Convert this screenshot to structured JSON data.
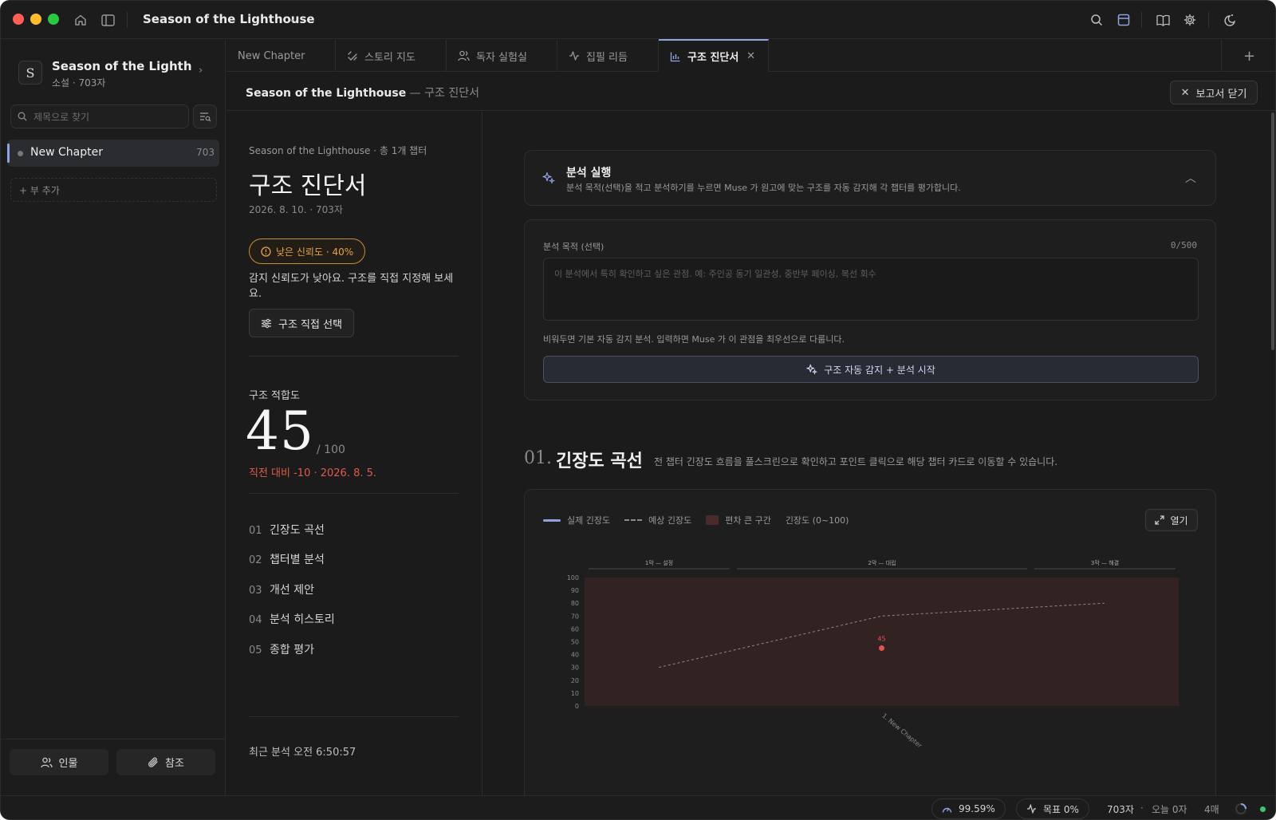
{
  "titlebar": {
    "title": "Season of the Lighthouse"
  },
  "sidebar": {
    "project_initial": "S",
    "project_name": "Season of the Lighthou...",
    "project_meta": "소설 · 703자",
    "search_placeholder": "제목으로 찾기",
    "chapter": {
      "name": "New Chapter",
      "count": "703"
    },
    "add_part": "+ 부 추가",
    "footer": {
      "characters": "인물",
      "references": "참조"
    }
  },
  "tabs": [
    {
      "label": "New Chapter",
      "icon": ""
    },
    {
      "label": "스토리 지도",
      "icon": "story-map-icon"
    },
    {
      "label": "독자 실험실",
      "icon": "users-icon"
    },
    {
      "label": "집필 리듬",
      "icon": "pulse-icon"
    },
    {
      "label": "구조 진단서",
      "icon": "bar-chart-icon"
    }
  ],
  "doc_header": {
    "title": "Season of the Lighthouse",
    "subtitle": " — 구조 진단서",
    "close_label": "보고서 닫기"
  },
  "left_panel": {
    "subtitle": "Season of the Lighthouse · 총 1개 챕터",
    "title": "구조 진단서",
    "date": "2026. 8. 10. · 703자",
    "confidence": "낮은 신뢰도 · 40%",
    "confidence_note": "감지 신뢰도가 낮아요. 구조를 직접 지정해 보세요.",
    "manual_select": "구조 직접 선택",
    "fit_label": "구조 적합도",
    "fit_score": "45",
    "fit_max": "/ 100",
    "fit_delta": "직전 대비 -10 · 2026. 8. 5.",
    "toc": [
      {
        "num": "01",
        "label": "긴장도 곡선"
      },
      {
        "num": "02",
        "label": "챕터별 분석"
      },
      {
        "num": "03",
        "label": "개선 제안"
      },
      {
        "num": "04",
        "label": "분석 히스토리"
      },
      {
        "num": "05",
        "label": "종합 평가"
      }
    ],
    "last_analysis": "최근 분석 오전 6:50:57"
  },
  "analysis": {
    "title": "분석 실행",
    "description": "분석 목적(선택)을 적고 분석하기를 누르면 Muse 가 원고에 맞는 구조를 자동 감지해 각 챕터를 평가합니다.",
    "purpose_label": "분석 목적 (선택)",
    "purpose_count": "0/500",
    "purpose_value": "",
    "purpose_placeholder": "이 분석에서 특히 확인하고 싶은 관점. 예: 주인공 동기 일관성, 중반부 페이싱, 복선 회수",
    "hint": "비워두면 기본 자동 감지 분석. 입력하면 Muse 가 이 관점을 최우선으로 다룹니다.",
    "start_button": "구조 자동 감지 + 분석 시작"
  },
  "section1": {
    "num": "01.",
    "title": "긴장도 곡선",
    "desc": "전 챕터 긴장도 흐름을 풀스크린으로 확인하고 포인트 클릭으로 해당 챕터 카드로 이동할 수 있습니다.",
    "legend": {
      "actual": "실제 긴장도",
      "expected": "예상 긴장도",
      "deviation": "편차 큰 구간",
      "scale": "긴장도 (0~100)"
    },
    "open_label": "열기"
  },
  "chart_data": {
    "type": "line",
    "ylim": [
      0,
      100
    ],
    "yticks": [
      0,
      10,
      20,
      30,
      40,
      50,
      60,
      70,
      80,
      90,
      100
    ],
    "acts": [
      "1막 — 설정",
      "2막 — 대립",
      "3막 — 해결"
    ],
    "categories": [
      "1. New Chapter"
    ],
    "series": [
      {
        "name": "실제 긴장도",
        "values": [
          45
        ]
      },
      {
        "name": "예상 긴장도",
        "x": [
          0.125,
          0.5,
          0.875
        ],
        "values": [
          30,
          70,
          80
        ]
      }
    ],
    "point_label": "45",
    "colors": {
      "actual": "#e0564d",
      "expected": "#8c8c8c",
      "deviation": "#3a2424",
      "accent": "#8fa3e0"
    }
  },
  "statusbar": {
    "score": "99.59%",
    "goal": "목표 0%",
    "chars": "703자",
    "today": "오늘 0자",
    "pages": "4매"
  }
}
